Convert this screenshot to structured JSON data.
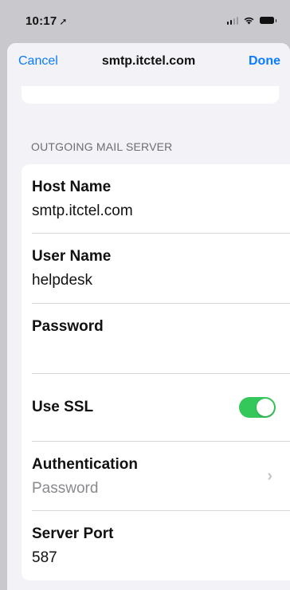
{
  "status_bar": {
    "time": "10:17",
    "location_icon": "location-arrow-icon",
    "icons": [
      "signal-icon",
      "wifi-icon",
      "battery-icon"
    ]
  },
  "nav": {
    "cancel_label": "Cancel",
    "title": "smtp.itctel.com",
    "done_label": "Done"
  },
  "section": {
    "header": "OUTGOING MAIL SERVER"
  },
  "fields": {
    "host_name": {
      "label": "Host Name",
      "value": "smtp.itctel.com"
    },
    "user_name": {
      "label": "User Name",
      "value": "helpdesk"
    },
    "password": {
      "label": "Password",
      "value": ""
    },
    "use_ssl": {
      "label": "Use SSL",
      "enabled": true
    },
    "authentication": {
      "label": "Authentication",
      "value": "Password"
    },
    "server_port": {
      "label": "Server Port",
      "value": "587"
    }
  },
  "colors": {
    "accent": "#0a7cff",
    "toggle_on": "#34c759",
    "background": "#f2f2f7",
    "secondary_text": "#8a8a8e"
  }
}
